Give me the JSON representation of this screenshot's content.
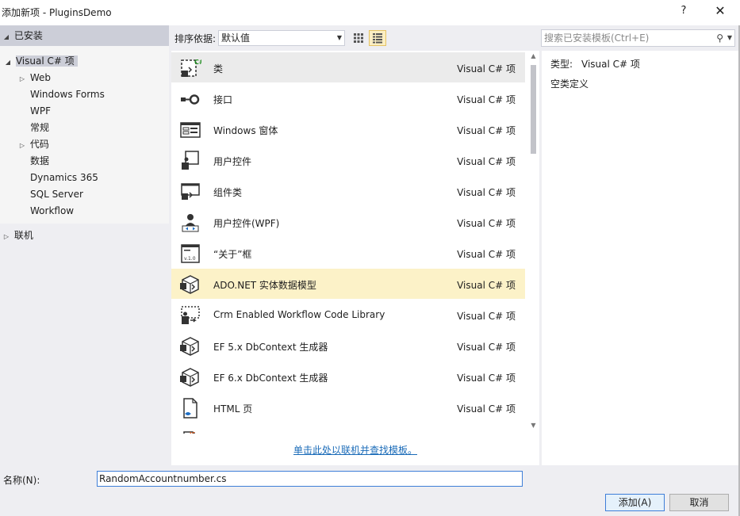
{
  "window": {
    "title": "添加新项 - PluginsDemo",
    "help_label": "?",
    "close_label": "✕"
  },
  "tree": {
    "installed": "已安装",
    "items": [
      {
        "label": "Visual C# 项",
        "expanded": true,
        "selected": true
      },
      {
        "label": "Web",
        "expandable": true
      },
      {
        "label": "Windows Forms"
      },
      {
        "label": "WPF"
      },
      {
        "label": "常规"
      },
      {
        "label": "代码",
        "expandable": true
      },
      {
        "label": "数据"
      },
      {
        "label": "Dynamics 365"
      },
      {
        "label": "SQL Server"
      },
      {
        "label": "Workflow"
      }
    ],
    "online": "联机"
  },
  "toolbar": {
    "sort_label": "排序依据:",
    "sort_value": "默认值"
  },
  "templates": [
    {
      "name": "类",
      "type": "Visual C# 项",
      "icon": "class-icon"
    },
    {
      "name": "接口",
      "type": "Visual C# 项",
      "icon": "interface-icon"
    },
    {
      "name": "Windows 窗体",
      "type": "Visual C# 项",
      "icon": "windows-form-icon"
    },
    {
      "name": "用户控件",
      "type": "Visual C# 项",
      "icon": "user-control-icon"
    },
    {
      "name": "组件类",
      "type": "Visual C# 项",
      "icon": "component-class-icon"
    },
    {
      "name": "用户控件(WPF)",
      "type": "Visual C# 项",
      "icon": "wpf-user-control-icon"
    },
    {
      "name": "“关于”框",
      "type": "Visual C# 项",
      "icon": "about-box-icon"
    },
    {
      "name": "ADO.NET 实体数据模型",
      "type": "Visual C# 项",
      "icon": "entity-data-model-icon"
    },
    {
      "name": "Crm Enabled Workflow Code Library",
      "type": "Visual C# 项",
      "icon": "workflow-library-icon"
    },
    {
      "name": "EF 5.x DbContext 生成器",
      "type": "Visual C# 项",
      "icon": "ef5-generator-icon"
    },
    {
      "name": "EF 6.x DbContext 生成器",
      "type": "Visual C# 项",
      "icon": "ef6-generator-icon"
    },
    {
      "name": "HTML 页",
      "type": "Visual C# 项",
      "icon": "html-page-icon"
    },
    {
      "name": "",
      "type": "",
      "icon": "javascript-file-icon"
    }
  ],
  "online_link": "单击此处以联机并查找模板。",
  "search": {
    "placeholder": "搜索已安装模板(Ctrl+E)"
  },
  "details": {
    "type_label": "类型:",
    "type_value": "Visual C# 项",
    "description": "空类定义"
  },
  "form": {
    "name_label": "名称(N):",
    "name_value": "RandomAccountnumber.cs",
    "add_label": "添加(A)",
    "cancel_label": "取消"
  },
  "colors": {
    "selection": "#ebebeb",
    "hover": "#fcf2c8",
    "link": "#1a6bb8",
    "accent_blue": "#3e7ed8",
    "tree_selected": "#ccced8"
  }
}
